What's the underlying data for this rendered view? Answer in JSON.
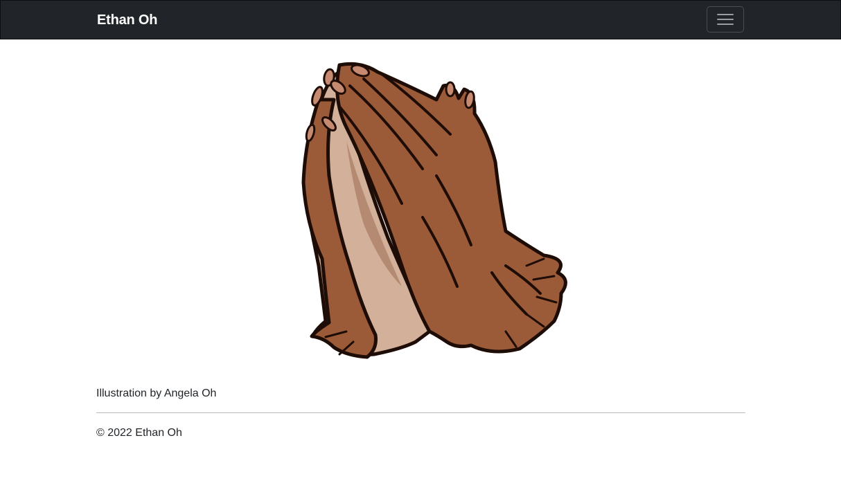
{
  "navbar": {
    "brand": "Ethan Oh",
    "toggler_icon": "hamburger-menu-icon"
  },
  "main": {
    "illustration": {
      "icon": "praying-hands-illustration",
      "colors": {
        "skin_dark": "#9c5b38",
        "skin_light": "#d2b09a",
        "skin_mid": "#b48a72",
        "outline": "#1e0c06",
        "nail": "#c58a70"
      }
    },
    "caption": "Illustration by Angela Oh"
  },
  "footer": {
    "copyright": "© 2022 Ethan Oh"
  },
  "colors": {
    "navbar_bg": "#212529",
    "page_bg": "#ffffff",
    "text": "#212529"
  }
}
